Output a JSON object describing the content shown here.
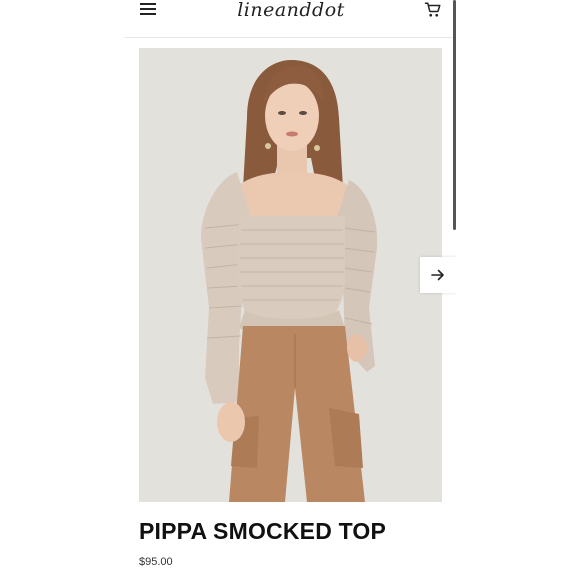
{
  "header": {
    "logo_text": "lineanddot",
    "menu_icon": "hamburger-menu-icon",
    "cart_icon": "shopping-cart-icon"
  },
  "gallery": {
    "next_icon": "arrow-right-icon"
  },
  "product": {
    "title": "PIPPA SMOCKED TOP",
    "price": "$95.00"
  },
  "colors": {
    "background": "#ffffff",
    "text": "#111111",
    "image_backdrop": "#e6e4df",
    "top_color": "#d9cbbd",
    "pants_color": "#b88760"
  }
}
